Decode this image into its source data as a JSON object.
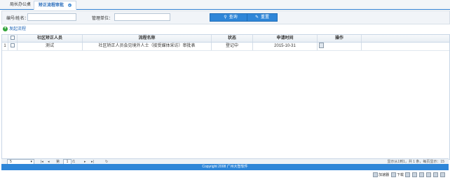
{
  "tabs": [
    {
      "label": "局长办公桌"
    },
    {
      "label": "矫正流程审批"
    }
  ],
  "search": {
    "name_label": "编号/姓名：",
    "unit_label": "管理单位：",
    "name_value": "",
    "unit_value": "",
    "search_button": "查询",
    "reset_button": "重置"
  },
  "toolbar": {
    "add_label": "发起流程"
  },
  "table": {
    "columns": [
      "社区矫正人员",
      "流程名称",
      "状态",
      "申请时间",
      "操作"
    ],
    "rows": [
      {
        "index": "1",
        "person": "测试",
        "process": "社区矫正人员会见境外人士（接受媒体采访）审批表",
        "status": "登记中",
        "date": "2015-10-31"
      }
    ]
  },
  "pager": {
    "page_size": "5",
    "page_prefix": "第",
    "current_page": "1",
    "total_pages": "/1",
    "summary": "显示从1到1，共 1 条，每页显示：15"
  },
  "footer": {
    "copyright": "Copyright 2008 广州大智软件"
  },
  "statusbar": {
    "items": [
      "加速器",
      "下载",
      "",
      "",
      "",
      "",
      ""
    ]
  }
}
